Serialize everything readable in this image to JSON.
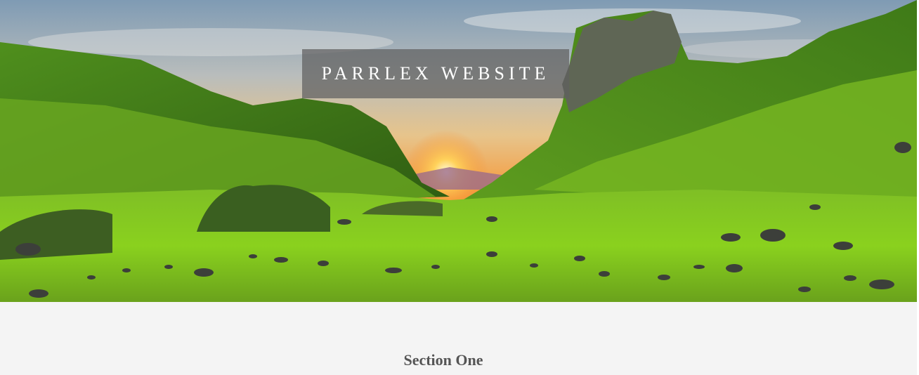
{
  "hero": {
    "title": "PARRLEX WEBSITE",
    "image": "landscape-photo"
  },
  "section": {
    "title": "Section One"
  },
  "colors": {
    "page_bg": "#f4f4f4",
    "title_box_bg": "#5f5f5f",
    "title_text": "#ffffff",
    "section_title": "#555555"
  }
}
